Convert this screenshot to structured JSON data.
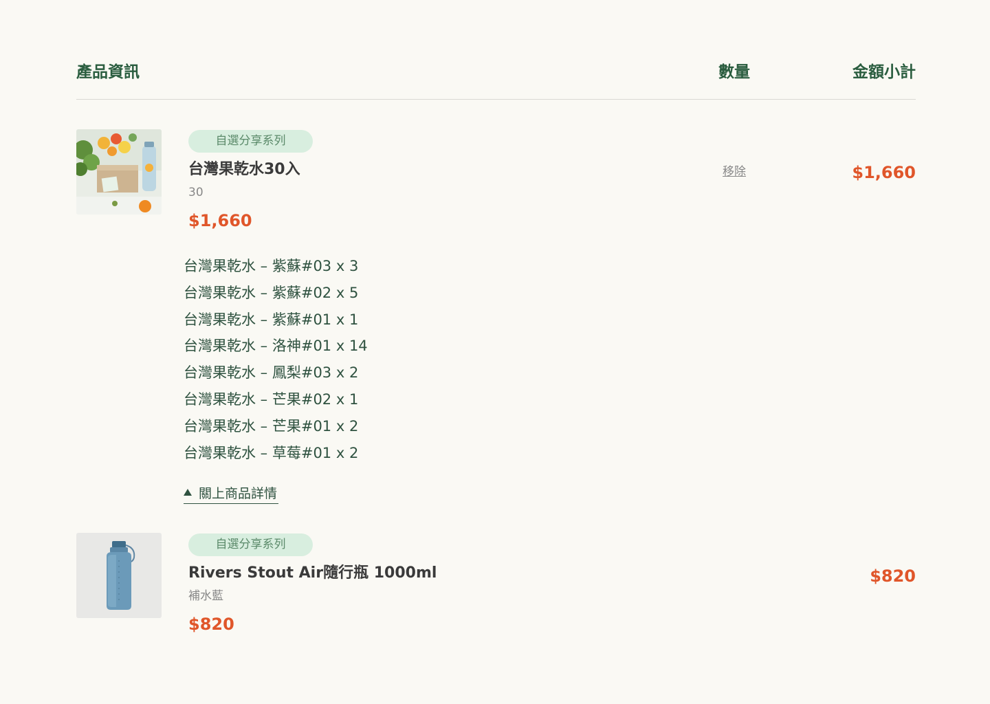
{
  "header": {
    "product_info": "產品資訊",
    "quantity": "數量",
    "subtotal": "金額小計"
  },
  "items": [
    {
      "tag": "自選分享系列",
      "name": "台灣果乾水30入",
      "variant": "30",
      "price": "$1,660",
      "remove_label": "移除",
      "subtotal": "$1,660",
      "image_icon": "fruit-water-gift-box-photo",
      "details": [
        "台灣果乾水 – 紫蘇#03 x 3",
        "台灣果乾水 – 紫蘇#02 x 5",
        "台灣果乾水 – 紫蘇#01 x 1",
        "台灣果乾水 – 洛神#01 x 14",
        "台灣果乾水 – 鳳梨#03 x 2",
        "台灣果乾水 – 芒果#02 x 1",
        "台灣果乾水 – 芒果#01 x 2",
        "台灣果乾水 – 草莓#01 x 2"
      ],
      "toggle_label": "關上商品詳情"
    },
    {
      "tag": "自選分享系列",
      "name": "Rivers Stout Air隨行瓶 1000ml",
      "variant": "補水藍",
      "price": "$820",
      "subtotal": "$820",
      "image_icon": "blue-water-bottle-photo"
    }
  ],
  "colors": {
    "accent_green": "#2a5d3f",
    "price_orange": "#e0562a",
    "tag_bg": "#d8eedf",
    "page_bg": "#faf9f4"
  }
}
